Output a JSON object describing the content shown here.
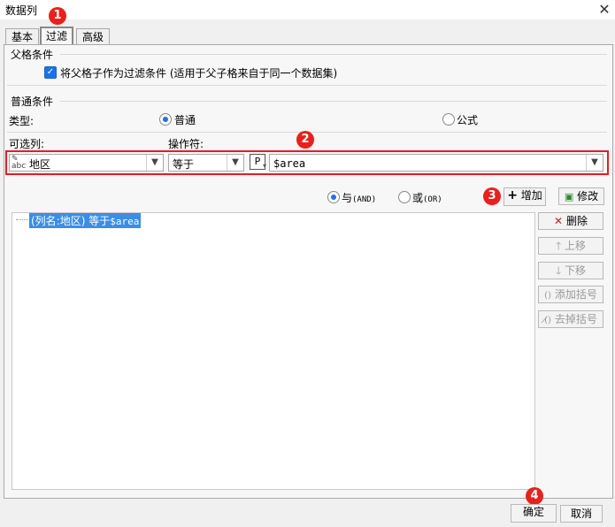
{
  "window": {
    "title": "数据列",
    "close_icon": "close-icon"
  },
  "tabs": [
    {
      "label": "基本"
    },
    {
      "label": "过滤"
    },
    {
      "label": "高级"
    }
  ],
  "parent_condition": {
    "group_title": "父格条件",
    "checkbox_label": "将父格子作为过滤条件 (适用于父子格来自于同一个数据集)",
    "checked": true
  },
  "normal_condition": {
    "group_title": "普通条件",
    "type_label": "类型:",
    "type_options": [
      "普通",
      "公式"
    ],
    "type_selected": "普通",
    "column_label": "可选列:",
    "operator_label": "操作符:",
    "column_value": "地区",
    "operator_value": "等于",
    "param_value": "$area"
  },
  "logic": {
    "and_label": "与",
    "and_suffix": "(AND)",
    "or_label": "或",
    "or_suffix": "(OR)",
    "selected": "and"
  },
  "actions": {
    "add": "增加",
    "modify": "修改",
    "delete": "删除",
    "move_up": "上移",
    "move_down": "下移",
    "add_bracket": "添加括号",
    "remove_bracket": "去掉括号"
  },
  "conditions": [
    {
      "text": "(列名:地区) 等于",
      "param": "$area"
    }
  ],
  "footer": {
    "ok": "确定",
    "cancel": "取消"
  },
  "badges": [
    "1",
    "2",
    "3",
    "4"
  ],
  "colors": {
    "annotation_red": "#e02020",
    "accent_blue": "#1a73e8",
    "selection": "#3a8ee6"
  }
}
